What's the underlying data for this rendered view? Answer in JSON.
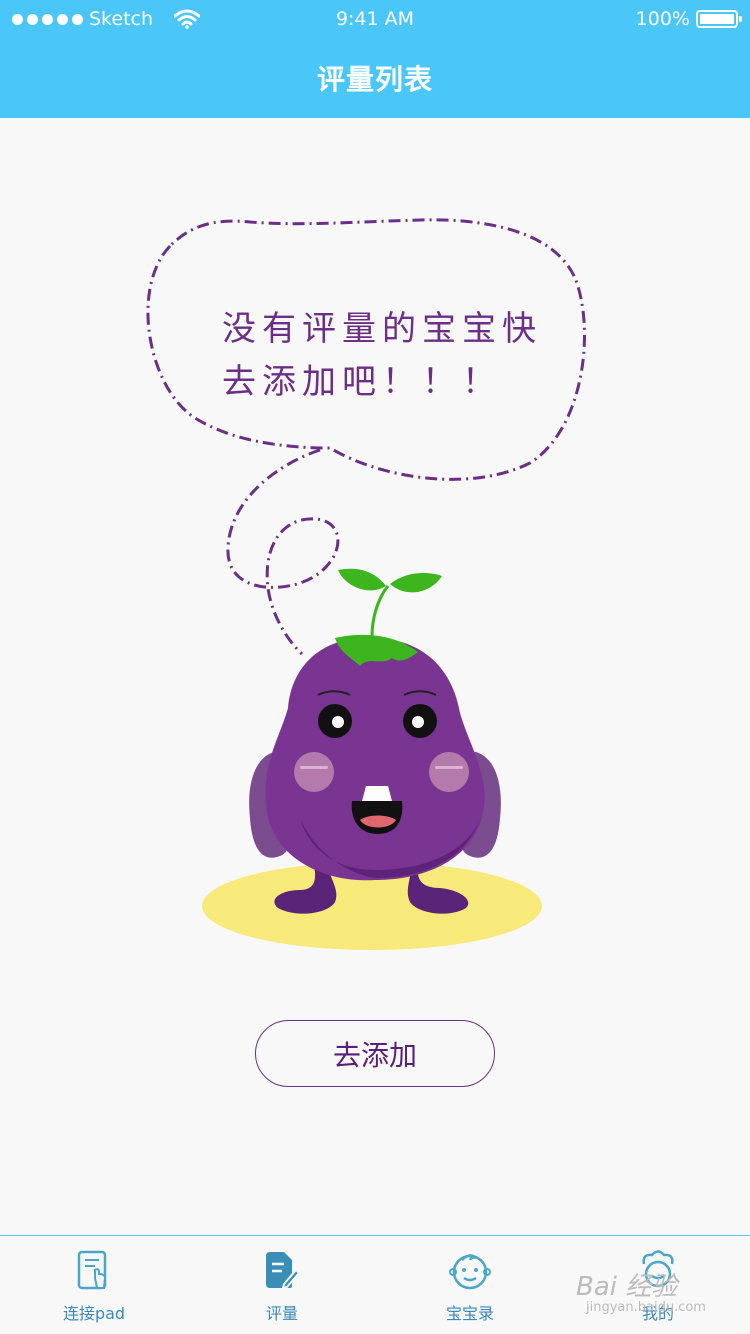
{
  "status_bar": {
    "carrier": "Sketch",
    "time": "9:41 AM",
    "battery": "100%"
  },
  "header": {
    "title": "评量列表"
  },
  "empty_state": {
    "message_line1": "没有评量的宝宝快",
    "message_line2": "去添加吧！！！",
    "button_label": "去添加"
  },
  "tabs": [
    {
      "label": "连接pad",
      "icon": "tablet-touch-icon"
    },
    {
      "label": "评量",
      "icon": "document-edit-icon"
    },
    {
      "label": "宝宝录",
      "icon": "baby-face-icon"
    },
    {
      "label": "我的",
      "icon": "chef-avatar-icon"
    }
  ],
  "watermark": {
    "text": "Bai 经验",
    "sub": "jingyan.baidu.com"
  },
  "colors": {
    "header": "#4ac6f9",
    "accent_purple": "#6b2f87",
    "tab_text": "#3a89b8"
  }
}
